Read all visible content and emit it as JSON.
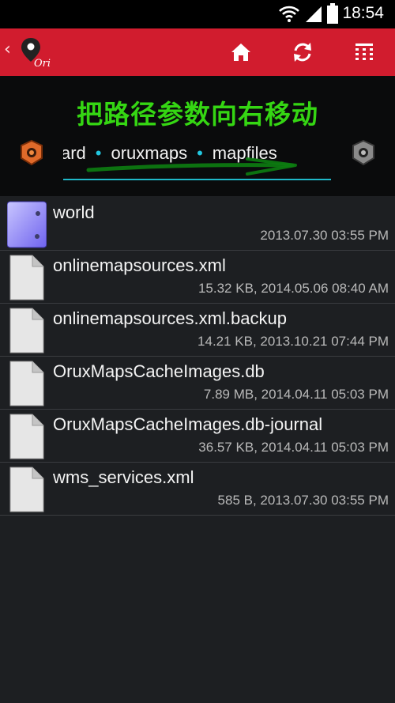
{
  "status_bar": {
    "time": "18:54"
  },
  "action_bar": {
    "back_icon": "chevron-left-icon",
    "logo_text": "Ori",
    "actions": [
      {
        "name": "home-icon"
      },
      {
        "name": "refresh-icon"
      },
      {
        "name": "grid-menu-icon"
      }
    ]
  },
  "overlay": {
    "caption": "把路径参数向右移动"
  },
  "breadcrumb": {
    "segments": [
      "card",
      "oruxmaps",
      "mapfiles"
    ],
    "separator": "•"
  },
  "files": [
    {
      "name": "world",
      "meta": "2013.07.30 03:55 PM",
      "type": "folder"
    },
    {
      "name": "onlinemapsources.xml",
      "meta": "15.32 KB, 2014.05.06 08:40 AM",
      "type": "file"
    },
    {
      "name": "onlinemapsources.xml.backup",
      "meta": "14.21 KB, 2013.10.21 07:44 PM",
      "type": "file"
    },
    {
      "name": "OruxMapsCacheImages.db",
      "meta": "7.89 MB, 2014.04.11 05:03 PM",
      "type": "file"
    },
    {
      "name": "OruxMapsCacheImages.db-journal",
      "meta": "36.57 KB, 2014.04.11 05:03 PM",
      "type": "file"
    },
    {
      "name": "wms_services.xml",
      "meta": "585 B, 2013.07.30 03:55 PM",
      "type": "file"
    }
  ],
  "colors": {
    "action_bar": "#d11c2e",
    "caption": "#35d613",
    "breadcrumb_accent": "#22c7e0"
  }
}
